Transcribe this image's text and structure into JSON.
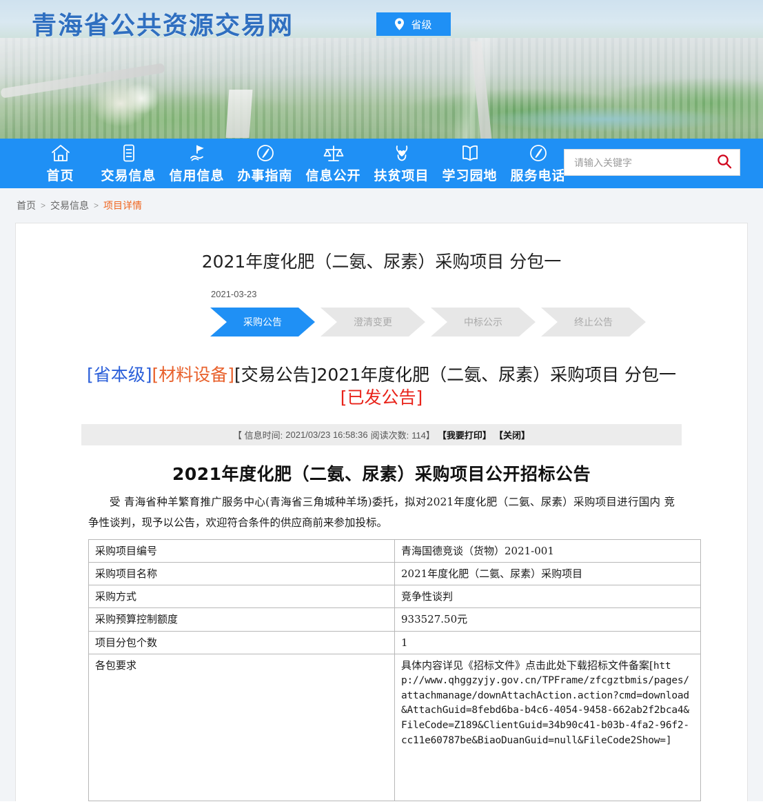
{
  "site": {
    "logo_text": "青海省公共资源交易网",
    "level_badge": "省级",
    "pin_icon": "location-pin-icon"
  },
  "nav": {
    "items": [
      {
        "label": "首页",
        "icon": "home-icon"
      },
      {
        "label": "交易信息",
        "icon": "document-list-icon"
      },
      {
        "label": "信用信息",
        "icon": "hand-flag-icon"
      },
      {
        "label": "办事指南",
        "icon": "compass-icon"
      },
      {
        "label": "信息公开",
        "icon": "scales-icon"
      },
      {
        "label": "扶贫项目",
        "icon": "heart-hands-icon"
      },
      {
        "label": "学习园地",
        "icon": "open-book-icon"
      },
      {
        "label": "服务电话",
        "icon": "compass-icon"
      }
    ]
  },
  "search": {
    "placeholder": "请输入关键字",
    "value": "",
    "icon": "search-icon",
    "icon_color": "#d0021b"
  },
  "breadcrumb": {
    "items": [
      "首页",
      "交易信息",
      "项目详情"
    ],
    "separator": ">",
    "current_color": "#f0651f"
  },
  "detail": {
    "title": "2021年度化肥（二氨、尿素）采购项目 分包一",
    "date": "2021-03-23",
    "steps": [
      {
        "label": "采购公告",
        "active": true
      },
      {
        "label": "澄清变更",
        "active": false
      },
      {
        "label": "中标公示",
        "active": false
      },
      {
        "label": "终止公告",
        "active": false
      }
    ],
    "headline": {
      "tag_region": "[省本级]",
      "tag_category": "[材料设备]",
      "tag_type": "[交易公告]",
      "main": "2021年度化肥（二氨、尿素）采购项目 分包一",
      "status": "[已发公告]",
      "colors": {
        "region": "#2b5fd9",
        "category": "#e8612c",
        "type": "#1a1a1a",
        "main": "#1a1a1a",
        "status": "#e8231a"
      }
    },
    "meta": {
      "prefix": "【 信息时间:",
      "time": "2021/03/23 16:58:36",
      "views_label": "阅读次数:",
      "views": "114】",
      "print_label": "【我要打印】",
      "close_label": "【关闭】"
    },
    "article": {
      "title": "2021年度化肥（二氨、尿素）采购项目公开招标公告",
      "paragraph": "受  青海省种羊繁育推广服务中心(青海省三角城种羊场)委托，拟对2021年度化肥（二氨、尿素）采购项目进行国内  竞争性谈判，现予以公告，欢迎符合条件的供应商前来参加投标。"
    },
    "table": {
      "rows": [
        {
          "key": "采购项目编号",
          "value": "青海国德竞谈（货物）2021-001"
        },
        {
          "key": "采购项目名称",
          "value": "2021年度化肥（二氨、尿素）采购项目"
        },
        {
          "key": "采购方式",
          "value": "竞争性谈判"
        },
        {
          "key": "采购预算控制额度",
          "value": "933527.50元"
        },
        {
          "key": "项目分包个数",
          "value": "1"
        }
      ],
      "requirements": {
        "key": "各包要求",
        "lead": "具体内容详见《招标文件》点击此处下载招标文件备案[",
        "url": "http://www.qhggzyjy.gov.cn/TPFrame/zfcgztbmis/pages/attachmanage/downAttachAction.action?cmd=download&AttachGuid=8febd6ba-b4c6-4054-9458-662ab2f2bca4&FileCode=Z189&ClientGuid=34b90c41-b03b-4fa2-96f2-cc11e60787be&BiaoDuanGuid=null&FileCode2Show=",
        "trail": "]"
      }
    }
  }
}
